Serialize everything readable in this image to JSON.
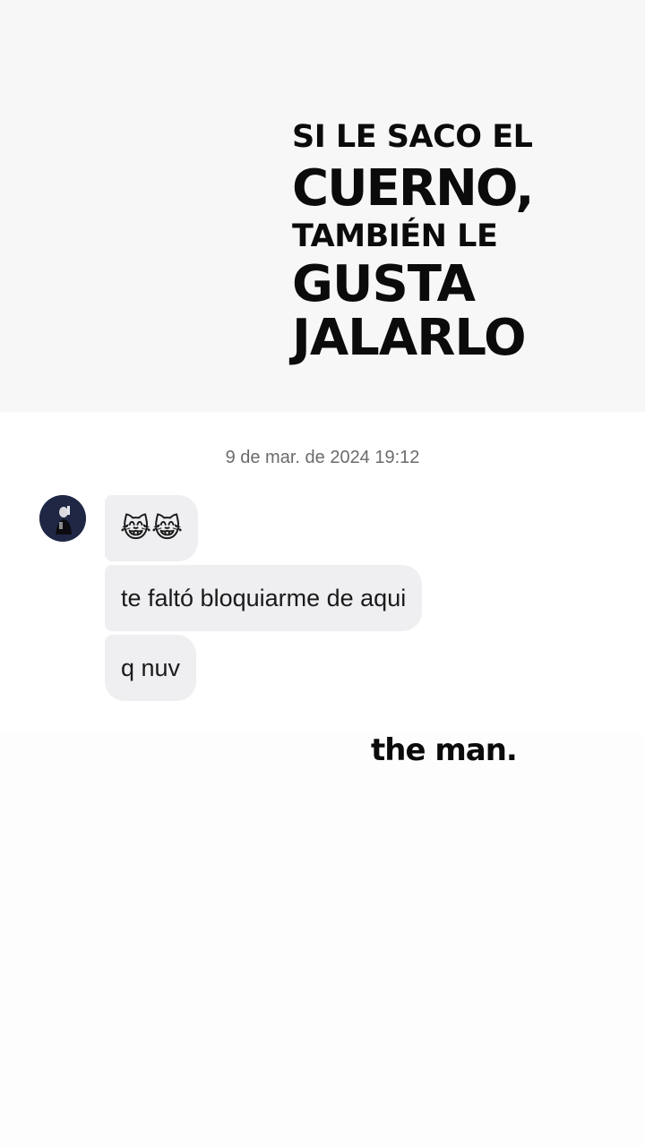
{
  "headline": {
    "line1": "SI LE SACO EL",
    "line2": "CUERNO,",
    "line3": "TAMBIÉN LE",
    "line4": "GUSTA",
    "line5": "JALARLO"
  },
  "chat": {
    "timestamp": "9 de mar. de 2024 19:12",
    "messages": [
      {
        "text": "😹😹"
      },
      {
        "text": "te faltó bloquiarme de aqui"
      },
      {
        "text": "q nuv"
      }
    ]
  },
  "caption": "the man."
}
